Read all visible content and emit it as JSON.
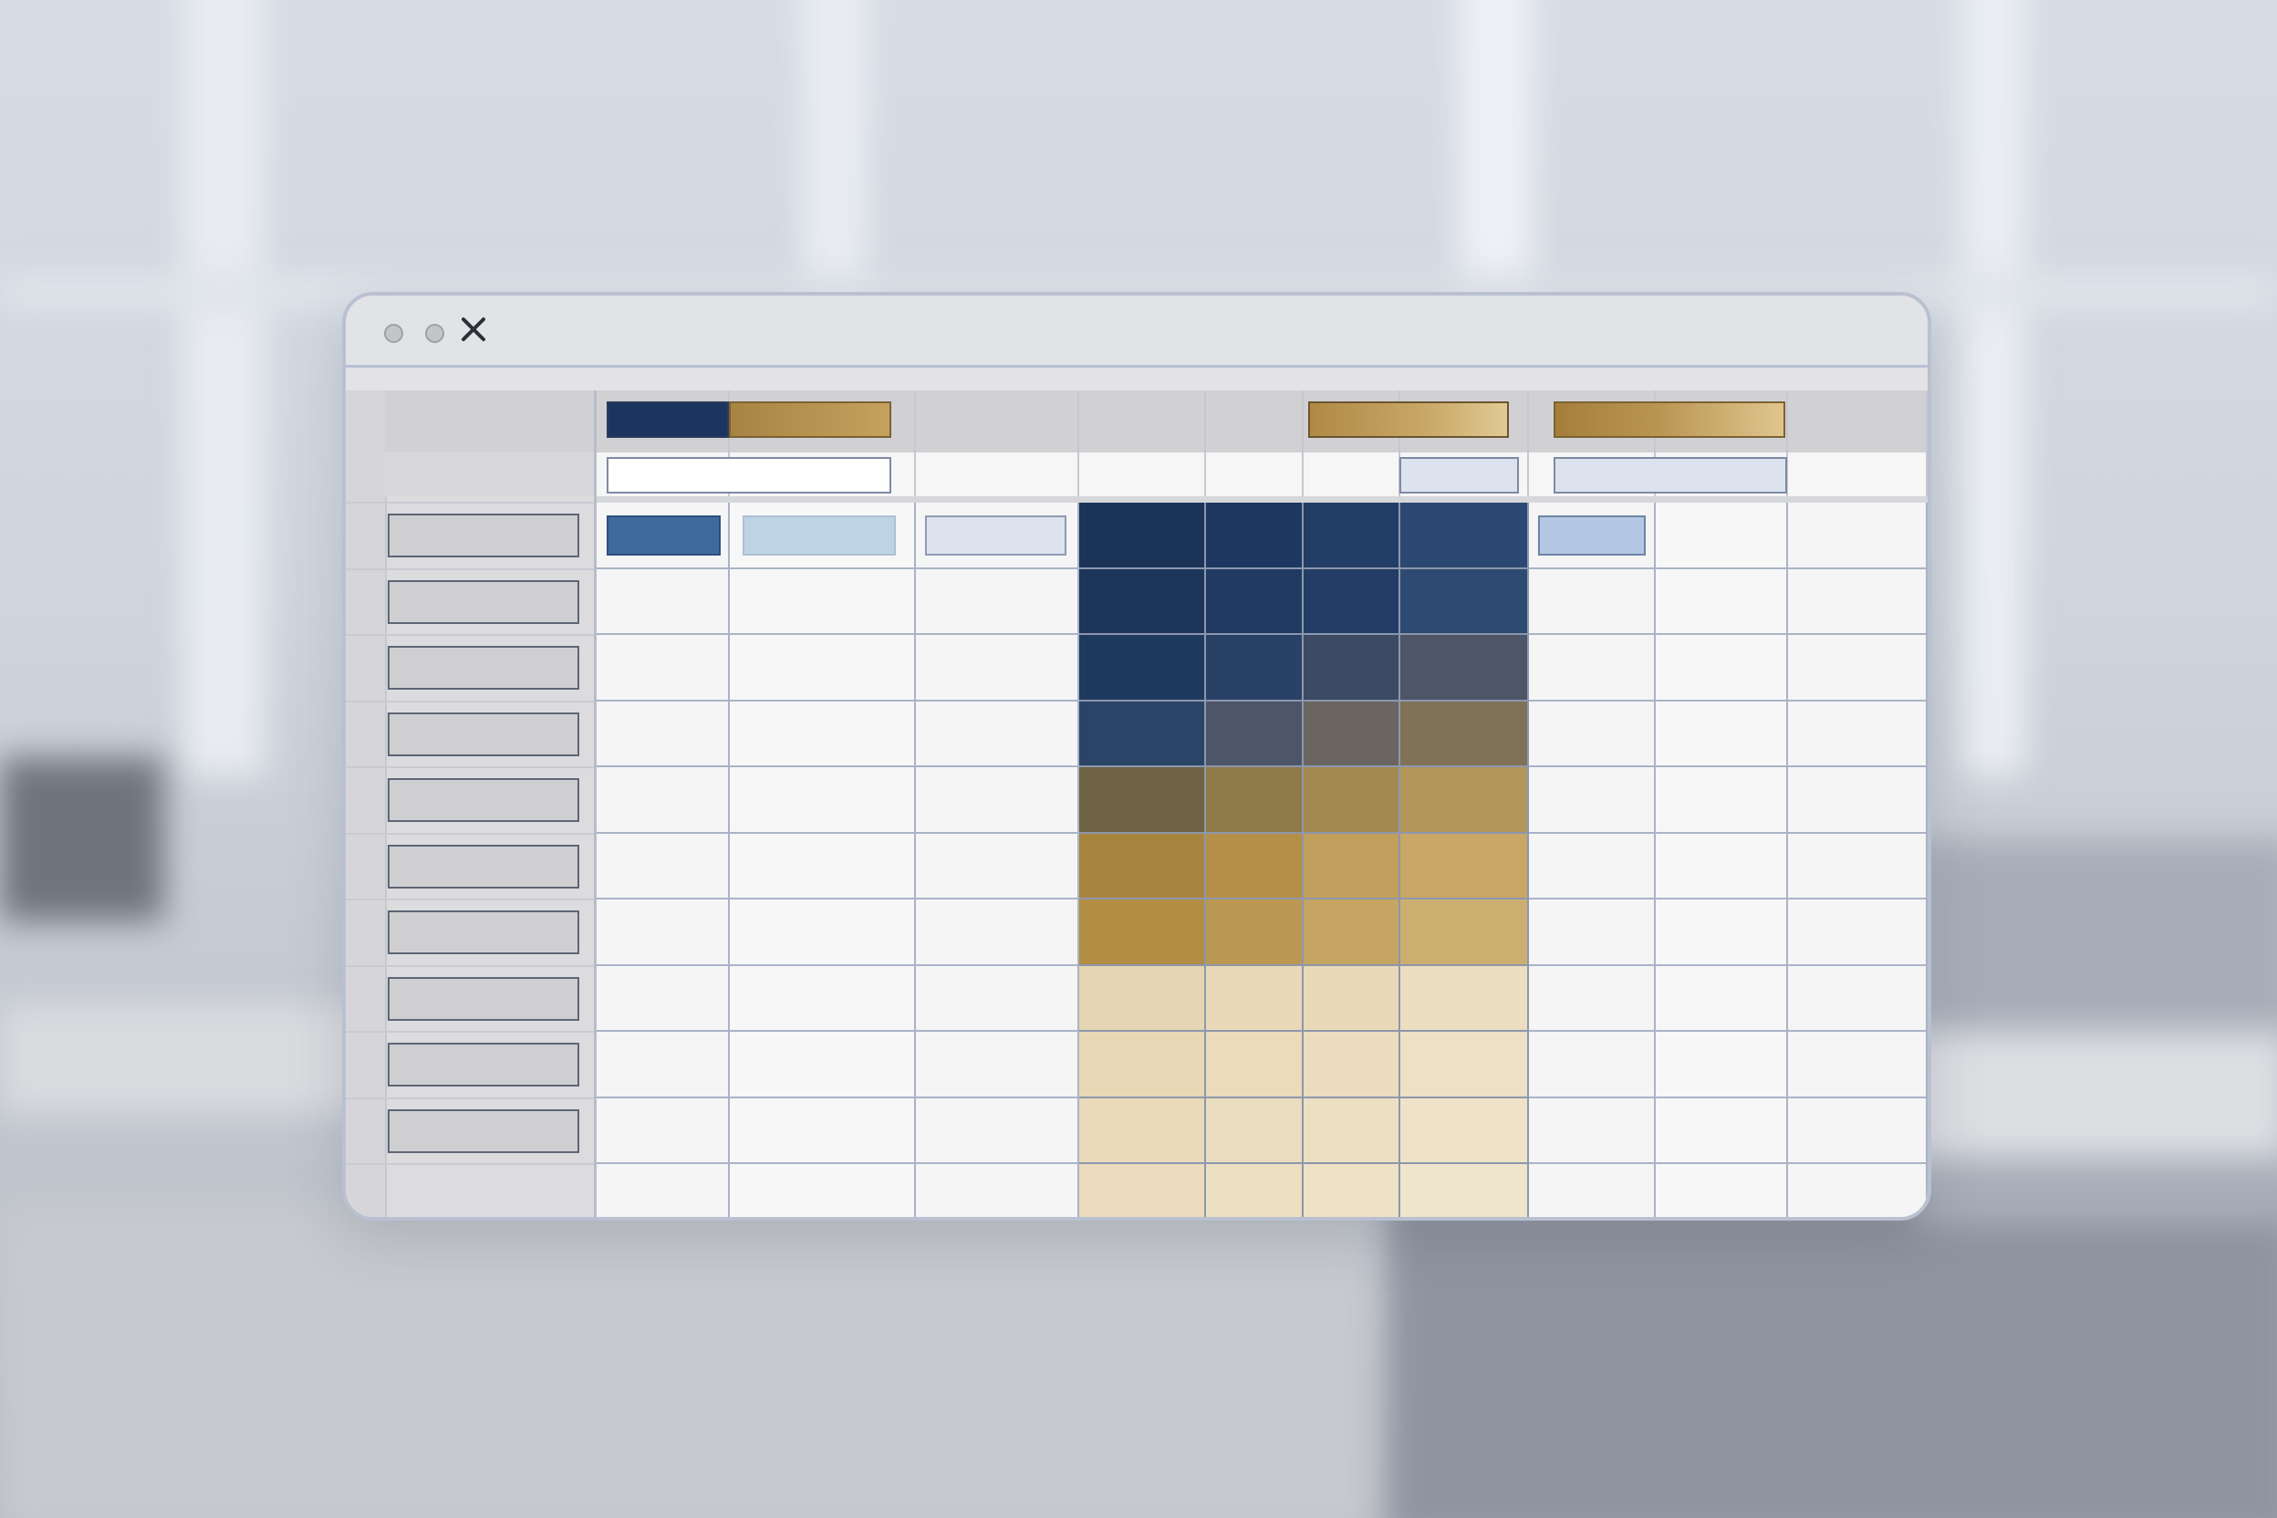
{
  "window": {
    "controls": [
      "minimize-button",
      "maximize-button",
      "close-button"
    ],
    "close_symbol": "✕"
  },
  "colors": {
    "navy": "#1b3560",
    "gold": "#b08a45",
    "light_gold": "#e8d9b8",
    "light_blue": "#bfd3e6",
    "pale_blue": "#dde3ee",
    "grid_line": "#aab3c6",
    "cell_bg": "#f5f5f6"
  },
  "rows": {
    "count": 10
  }
}
